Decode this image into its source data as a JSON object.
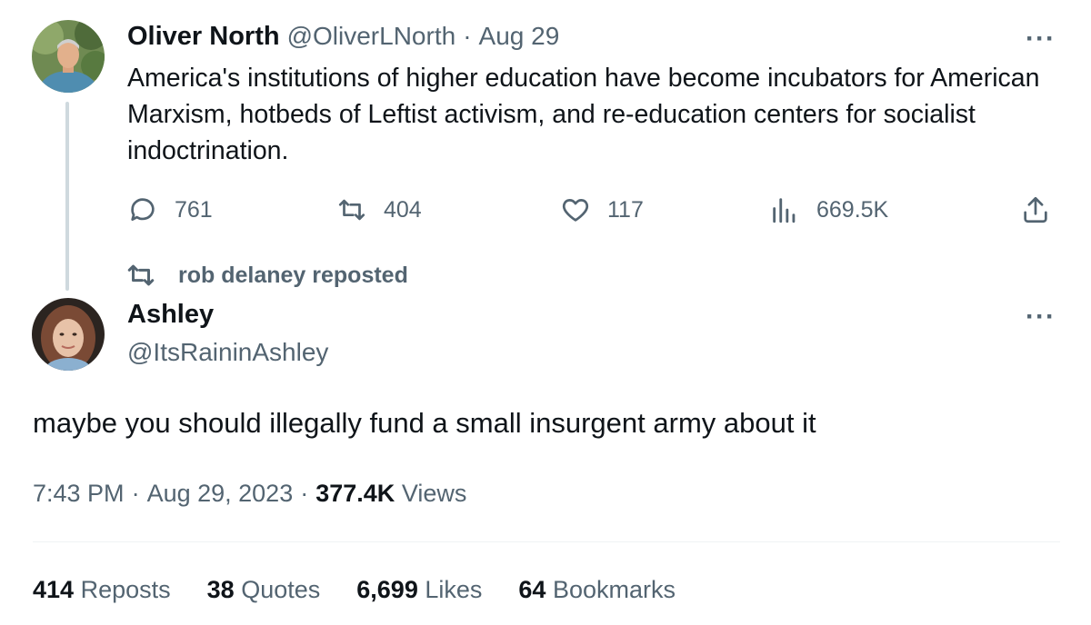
{
  "quoted_tweet": {
    "author_name": "Oliver North",
    "author_handle": "@OliverLNorth",
    "separator": "·",
    "date": "Aug 29",
    "more": "···",
    "text": "America's institutions of higher education have become incubators for American Marxism, hotbeds of Leftist activism, and re-education centers for socialist indoctrination.",
    "actions": {
      "replies": "761",
      "reposts": "404",
      "likes": "117",
      "views": "669.5K"
    }
  },
  "repost_banner": {
    "text": "rob delaney reposted"
  },
  "main_tweet": {
    "author_name": "Ashley",
    "author_handle": "@ItsRaininAshley",
    "more": "···",
    "text": "maybe you should illegally fund a small insurgent army about it",
    "time": "7:43 PM",
    "date": "Aug 29, 2023",
    "separator": "·",
    "views_count": "377.4K",
    "views_label": "Views"
  },
  "stats": [
    {
      "count": "414",
      "label": "Reposts"
    },
    {
      "count": "38",
      "label": "Quotes"
    },
    {
      "count": "6,699",
      "label": "Likes"
    },
    {
      "count": "64",
      "label": "Bookmarks"
    }
  ],
  "colors": {
    "text": "#0f1419",
    "muted": "#536471",
    "thread_line": "#cfd9de",
    "divider": "#eff3f4"
  }
}
